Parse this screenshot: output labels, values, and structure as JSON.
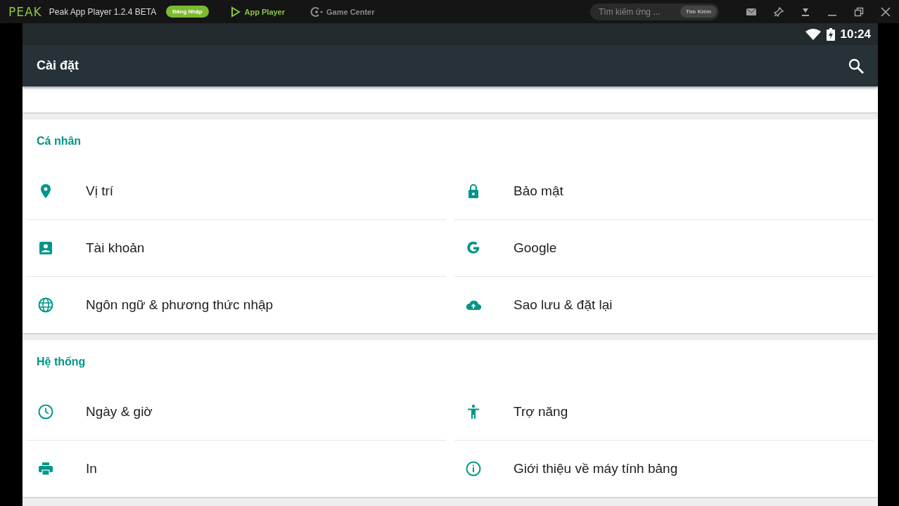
{
  "emulator_bar": {
    "logo": "PEAK",
    "title": "Peak App Player 1.2.4 BETA",
    "login_button": "Đăng Nhập",
    "tabs": [
      {
        "label": "App Player",
        "selected": true
      },
      {
        "label": "Game Center",
        "selected": false
      }
    ],
    "search": {
      "placeholder": "Tìm kiếm ứng ...",
      "button": "Tìm Kiếm"
    }
  },
  "status_bar": {
    "time": "10:24"
  },
  "toolbar": {
    "title": "Cài đặt"
  },
  "sections": [
    {
      "header": "Cá nhân",
      "items": [
        {
          "label": "Vị trí",
          "kind": "location"
        },
        {
          "label": "Bảo mật",
          "kind": "lock"
        },
        {
          "label": "Tài khoản",
          "kind": "account"
        },
        {
          "label": "Google",
          "kind": "google"
        },
        {
          "label": "Ngôn ngữ & phương thức nhập",
          "kind": "globe"
        },
        {
          "label": "Sao lưu & đặt lại",
          "kind": "cloud"
        }
      ]
    },
    {
      "header": "Hệ thống",
      "items": [
        {
          "label": "Ngày & giờ",
          "kind": "clock"
        },
        {
          "label": "Trợ năng",
          "kind": "accessibility"
        },
        {
          "label": "In",
          "kind": "print"
        },
        {
          "label": "Giới thiệu về máy tính bảng",
          "kind": "info"
        }
      ]
    }
  ]
}
